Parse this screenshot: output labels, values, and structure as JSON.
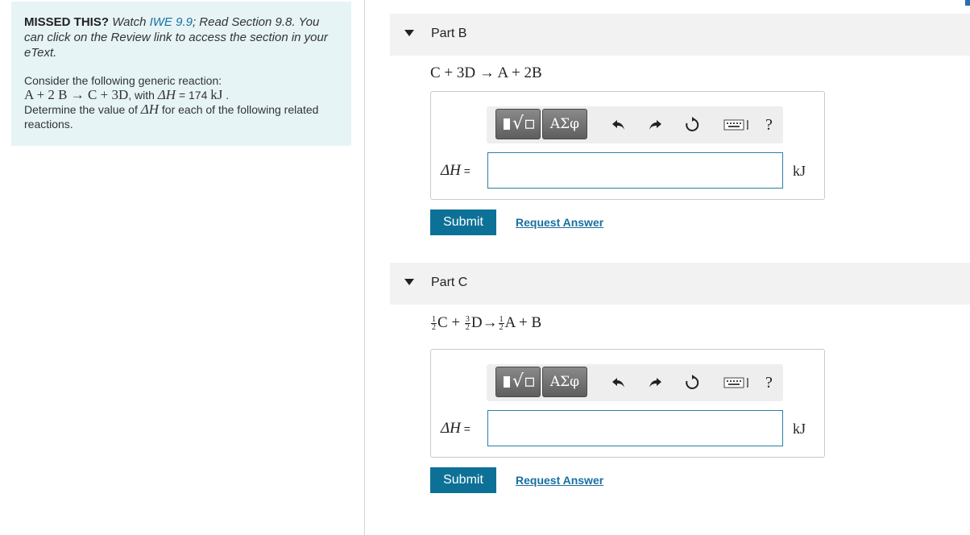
{
  "info": {
    "missed_label": "MISSED THIS?",
    "watch_prefix": "Watch",
    "iwe_link": "IWE 9.9",
    "read_text": "; Read Section 9.8. You can click on the Review link to access the section in your eText.",
    "consider_line": "Consider the following generic reaction:",
    "reaction_eq": "A + 2 B → C + 3D",
    "with_text": ", with",
    "dh_symbol": "ΔH",
    "dh_value_text": " = 174 ",
    "dh_unit": "kJ",
    "period": " .",
    "determine_prefix": "Determine the value of",
    "determine_suffix": "for each of the following related reactions."
  },
  "parts": [
    {
      "title": "Part B",
      "reaction": "C + 3D → A + 2B",
      "dh_label": "ΔH",
      "dh_equals": " =",
      "input_value": "",
      "unit": "kJ",
      "submit_label": "Submit",
      "request_label": "Request Answer"
    },
    {
      "title": "Part C",
      "reaction_terms": {
        "f1_num": "1",
        "f1_den": "2",
        "t1": "C + ",
        "f2_num": "3",
        "f2_den": "2",
        "t2": "D→",
        "f3_num": "1",
        "f3_den": "2",
        "t3": "A + B"
      },
      "dh_label": "ΔH",
      "dh_equals": " =",
      "input_value": "",
      "unit": "kJ",
      "submit_label": "Submit",
      "request_label": "Request Answer"
    }
  ],
  "toolbar": {
    "templates_icon": "radical-template-icon",
    "greek_label": "ΑΣφ",
    "undo_icon": "undo-icon",
    "redo_icon": "redo-icon",
    "reset_icon": "reset-icon",
    "keyboard_icon": "keyboard-icon",
    "help_label": "?"
  },
  "colors": {
    "info_bg": "#e6f4f6",
    "link": "#1a6fa0",
    "submit_bg": "#0d7197",
    "input_border": "#2a7fa7"
  }
}
